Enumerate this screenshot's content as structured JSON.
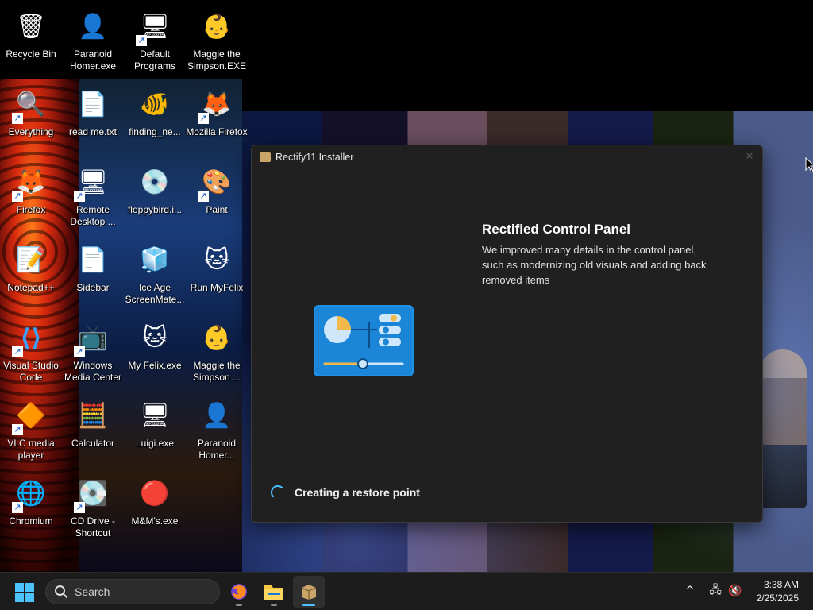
{
  "desktop": {
    "icons": [
      {
        "label": "Recycle Bin",
        "icon": "recycle-bin-icon",
        "glyph": "🗑"
      },
      {
        "label": "Paranoid Homer.exe",
        "icon": "homer-icon",
        "glyph": "👤"
      },
      {
        "label": "Default Programs",
        "icon": "default-programs-icon",
        "glyph": "🖥"
      },
      {
        "label": "Maggie the Simpson.EXE",
        "icon": "maggie-icon",
        "glyph": "👶"
      },
      {
        "label": "Everything",
        "icon": "everything-search-icon",
        "glyph": "🔍"
      },
      {
        "label": "read me.txt",
        "icon": "text-file-icon",
        "glyph": "📄"
      },
      {
        "label": "finding_ne...",
        "icon": "fish-icon",
        "glyph": "🐠"
      },
      {
        "label": "Mozilla Firefox",
        "icon": "firefox-icon",
        "glyph": "🦊"
      },
      {
        "label": "Firefox",
        "icon": "firefox-icon",
        "glyph": "🦊"
      },
      {
        "label": "Remote Desktop ...",
        "icon": "remote-desktop-icon",
        "glyph": "🖥"
      },
      {
        "label": "floppybird.i...",
        "icon": "disc-image-icon",
        "glyph": "💿"
      },
      {
        "label": "Paint",
        "icon": "paint-icon",
        "glyph": "🎨"
      },
      {
        "label": "Notepad++",
        "icon": "notepadpp-icon",
        "glyph": "📝"
      },
      {
        "label": "Sidebar",
        "icon": "blank-file-icon",
        "glyph": "📄"
      },
      {
        "label": "Ice Age ScreenMate...",
        "icon": "ice-age-icon",
        "glyph": "🧊"
      },
      {
        "label": "Run MyFelix",
        "icon": "felix-icon",
        "glyph": "🐱"
      },
      {
        "label": "Visual Studio Code",
        "icon": "vscode-icon",
        "glyph": "⟨⟩"
      },
      {
        "label": "Windows Media Center",
        "icon": "media-center-icon",
        "glyph": "📺"
      },
      {
        "label": "My Felix.exe",
        "icon": "felix-icon",
        "glyph": "🐱"
      },
      {
        "label": "Maggie the Simpson ...",
        "icon": "maggie-icon",
        "glyph": "👶"
      },
      {
        "label": "VLC media player",
        "icon": "vlc-icon",
        "glyph": "🔶"
      },
      {
        "label": "Calculator",
        "icon": "calculator-icon",
        "glyph": "🧮"
      },
      {
        "label": "Luigi.exe",
        "icon": "luigi-icon",
        "glyph": "🖥"
      },
      {
        "label": "Paranoid Homer...",
        "icon": "homer-icon",
        "glyph": "👤"
      },
      {
        "label": "Chromium",
        "icon": "chromium-icon",
        "glyph": "🌐"
      },
      {
        "label": "CD Drive - Shortcut",
        "icon": "cd-drive-icon",
        "glyph": "💽"
      },
      {
        "label": "M&M's.exe",
        "icon": "mms-icon",
        "glyph": "🔴"
      }
    ]
  },
  "installer": {
    "title": "Rectify11 Installer",
    "close_glyph": "✕",
    "feature_title": "Rectified Control Panel",
    "feature_description": "We improved many details in the control panel, such as modernizing old visuals and adding back removed items",
    "status": "Creating a restore point"
  },
  "taskbar": {
    "search_placeholder": "Search",
    "apps": [
      {
        "name": "Firefox",
        "icon": "firefox-icon",
        "active": false
      },
      {
        "name": "File Explorer",
        "icon": "file-explorer-icon",
        "active": false
      },
      {
        "name": "Rectify11 Installer",
        "icon": "installer-icon",
        "active": true
      }
    ],
    "tray": {
      "overflow_glyph": "^",
      "network_glyph": "🖧",
      "volume_glyph": "🔇"
    },
    "clock": {
      "time": "3:38 AM",
      "date": "2/25/2025"
    }
  },
  "colors": {
    "accent": "#4cc2ff",
    "window_bg": "#202020",
    "taskbar_bg": "#1c1c1c"
  }
}
